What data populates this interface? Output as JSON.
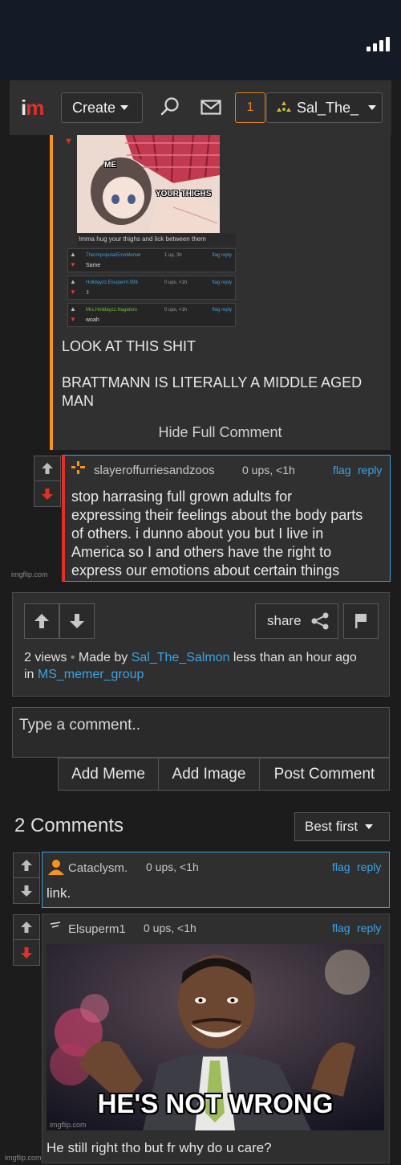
{
  "nav": {
    "create_label": "Create",
    "notification_count": "1",
    "username_label": "Sal_The_"
  },
  "thread": {
    "embedded_image": {
      "text_me": "ME",
      "text_your_thighs": "YOUR THIGHS",
      "caption": "Imma hug your thighs and lick between them"
    },
    "mini_comments": [
      {
        "user": "TheUnpopularEmoMemer",
        "meta": "1 up, 3h",
        "links": "flag reply",
        "text": "Same"
      },
      {
        "user": "Holidayzz.Elsuperm.999",
        "meta": "0 ups, <1h",
        "links": "flag reply",
        "text": ":l"
      },
      {
        "user": "Mrs.Holidayzz.Nagatoro",
        "meta": "0 ups, <1h",
        "links": "flag reply",
        "text": "woah"
      }
    ],
    "text_line1": "LOOK AT THIS SHIT",
    "text_line2": "BRATTMANN IS LITERALLY A MIDDLE AGED",
    "text_line3": "MAN",
    "hide_full_comment": "Hide Full Comment",
    "reply": {
      "user": "slayeroffurriesandzoos",
      "meta": "0 ups, <1h",
      "flag": "flag",
      "reply": "reply",
      "lines": [
        "stop harrasing full grown adults for",
        "expressing their feelings about the body parts",
        "of others. i dunno about you but I live in",
        "America so I and others have the right to",
        "express our emotions about certain things"
      ]
    },
    "watermark": "imgflip.com"
  },
  "meme_info": {
    "share_label": "share",
    "views": "2 views",
    "separator": "•",
    "made_by": "Made by",
    "author": "Sal_The_Salmon",
    "time": "less than an hour ago",
    "in_label": "in",
    "group": "MS_memer_group"
  },
  "comment_box": {
    "placeholder": "Type a comment..",
    "add_meme": "Add Meme",
    "add_image": "Add Image",
    "post_comment": "Post Comment"
  },
  "comments_section": {
    "title": "2 Comments",
    "sort_label": "Best first",
    "comments": [
      {
        "user": "Cataclysm.",
        "meta": "0 ups, <1h",
        "flag": "flag",
        "reply": "reply",
        "text": "link."
      },
      {
        "user": "Elsuperm1",
        "meta": "0 ups, <1h",
        "flag": "flag",
        "reply": "reply",
        "meme_caption": "HE'S NOT WRONG",
        "image_watermark": "imgflip.com",
        "text": "He still right tho but fr why do u care?"
      }
    ],
    "footer_watermark": "imgflip.com"
  },
  "colors": {
    "accent_blue": "#3aa3e3",
    "accent_orange": "#f7941d",
    "accent_red": "#e0302a",
    "background": "#1c1c1c"
  }
}
